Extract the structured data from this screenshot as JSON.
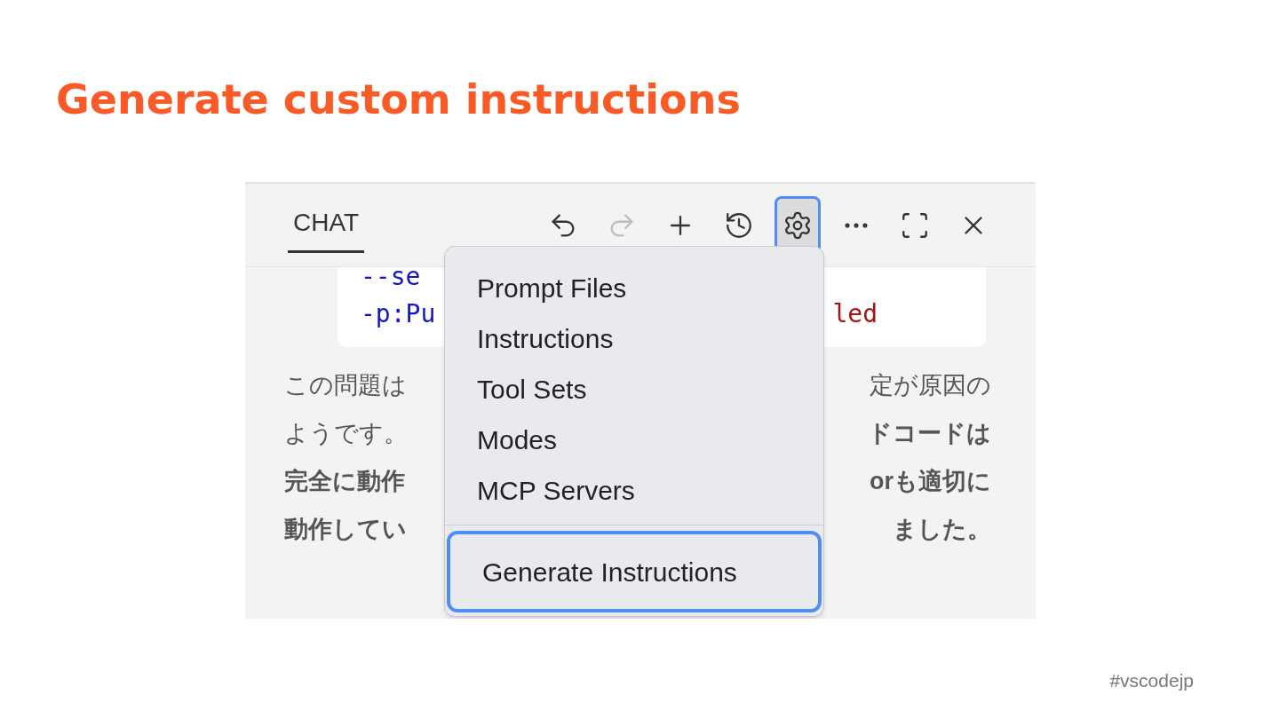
{
  "slide": {
    "title": "Generate custom instructions",
    "footer": "#vscodejp"
  },
  "chat": {
    "tab": {
      "label": "CHAT",
      "selected": true
    },
    "toolbar": [
      {
        "kind": "undo",
        "disabled": false,
        "selected": false
      },
      {
        "kind": "redo",
        "disabled": true,
        "selected": false
      },
      {
        "kind": "new",
        "disabled": false,
        "selected": false
      },
      {
        "kind": "history",
        "disabled": false,
        "selected": false
      },
      {
        "kind": "settings",
        "disabled": false,
        "selected": true
      },
      {
        "kind": "more",
        "disabled": false,
        "selected": false
      },
      {
        "kind": "maximize",
        "disabled": false,
        "selected": false
      },
      {
        "kind": "close",
        "disabled": false,
        "selected": false
      }
    ],
    "code_lines": [
      {
        "left": "--se"
      },
      {
        "left": "-p:Pu",
        "right": "led"
      }
    ],
    "body_lines": [
      {
        "left": {
          "text": "この問題は",
          "bold": false
        },
        "right": {
          "text": "定が原因の",
          "bold": false
        }
      },
      {
        "left": {
          "text": "ようです。",
          "bold": false
        },
        "right": {
          "text": "ドコードは",
          "bold": true
        }
      },
      {
        "left": {
          "text": "完全に動作",
          "bold": true
        },
        "right": {
          "text": "orも適切に",
          "bold": true
        }
      },
      {
        "left": {
          "text": "動作してい",
          "bold": true
        },
        "right": {
          "text": "ました。",
          "bold": true
        }
      }
    ],
    "menu": {
      "groups": [
        [
          {
            "label": "Prompt Files",
            "selected": false
          },
          {
            "label": "Instructions",
            "selected": false
          },
          {
            "label": "Tool Sets",
            "selected": false
          },
          {
            "label": "Modes",
            "selected": false
          },
          {
            "label": "MCP Servers",
            "selected": false
          }
        ],
        [
          {
            "label": "Generate Instructions",
            "selected": true
          }
        ]
      ]
    }
  }
}
